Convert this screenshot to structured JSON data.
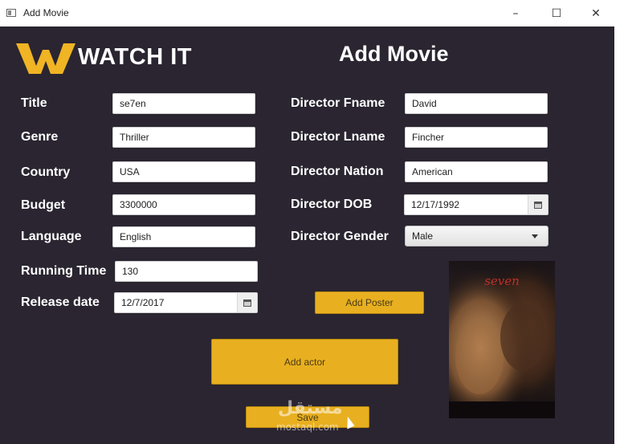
{
  "window": {
    "title": "Add Movie",
    "controls": {
      "minimize": "–",
      "maximize": "☐",
      "close": "✕"
    }
  },
  "brand": {
    "name": "WATCH IT",
    "accent": "#f0b424"
  },
  "heading": "Add Movie",
  "movie_form": {
    "title": {
      "label": "Title",
      "value": "se7en"
    },
    "genre": {
      "label": "Genre",
      "value": "Thriller"
    },
    "country": {
      "label": "Country",
      "value": "USA"
    },
    "budget": {
      "label": "Budget",
      "value": "3300000"
    },
    "language": {
      "label": "Language",
      "value": "English"
    },
    "running_time": {
      "label": "Running Time",
      "value": "130"
    },
    "release_date": {
      "label": "Release date",
      "value": "12/7/2017"
    }
  },
  "director_form": {
    "fname": {
      "label": "Director Fname",
      "value": "David"
    },
    "lname": {
      "label": "Director Lname",
      "value": "Fincher"
    },
    "nation": {
      "label": "Director Nation",
      "value": "American"
    },
    "dob": {
      "label": "Director DOB",
      "value": "12/17/1992"
    },
    "gender": {
      "label": "Director Gender",
      "value": "Male"
    }
  },
  "buttons": {
    "add_poster": "Add Poster",
    "add_actor": "Add actor",
    "save": "Save"
  },
  "poster": {
    "title_text": "seven"
  },
  "watermark": {
    "arabic": "مستقل",
    "latin": "mostaql.com"
  }
}
